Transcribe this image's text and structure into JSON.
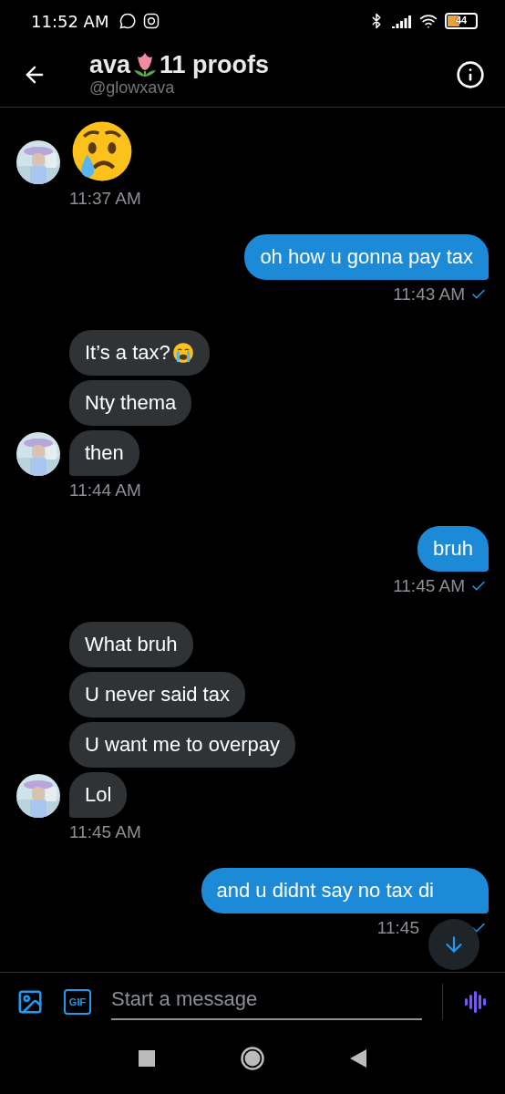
{
  "status_bar": {
    "time": "11:52 AM",
    "battery": "44"
  },
  "header": {
    "name": "ava",
    "name_after": "11 proofs",
    "handle": "@glowxava"
  },
  "groups": [
    {
      "kind": "incoming",
      "time": "11:37 AM",
      "read": false,
      "messages": [
        {
          "kind": "emoji"
        }
      ]
    },
    {
      "kind": "outgoing",
      "time": "11:43 AM",
      "read": true,
      "messages": [
        {
          "kind": "text",
          "text": "oh how u gonna pay tax"
        }
      ]
    },
    {
      "kind": "incoming",
      "time": "11:44 AM",
      "read": false,
      "messages": [
        {
          "kind": "text",
          "text": "It’s a tax?",
          "sob": true
        },
        {
          "kind": "text",
          "text": "Nty thema",
          "sob": false
        },
        {
          "kind": "text",
          "text": "then",
          "sob": false
        }
      ]
    },
    {
      "kind": "outgoing",
      "time": "11:45 AM",
      "read": true,
      "messages": [
        {
          "kind": "text",
          "text": "bruh"
        }
      ]
    },
    {
      "kind": "incoming",
      "time": "11:45 AM",
      "read": false,
      "messages": [
        {
          "kind": "text",
          "text": "What bruh"
        },
        {
          "kind": "text",
          "text": "U never said tax"
        },
        {
          "kind": "text",
          "text": "U want me to overpay"
        },
        {
          "kind": "text",
          "text": "Lol"
        }
      ]
    },
    {
      "kind": "outgoing",
      "time": "11:45",
      "read": true,
      "covered": true,
      "messages": [
        {
          "kind": "text",
          "text": "and u didnt say no tax di"
        }
      ]
    }
  ],
  "composer": {
    "gif_label": "GIF",
    "placeholder": "Start a message"
  }
}
